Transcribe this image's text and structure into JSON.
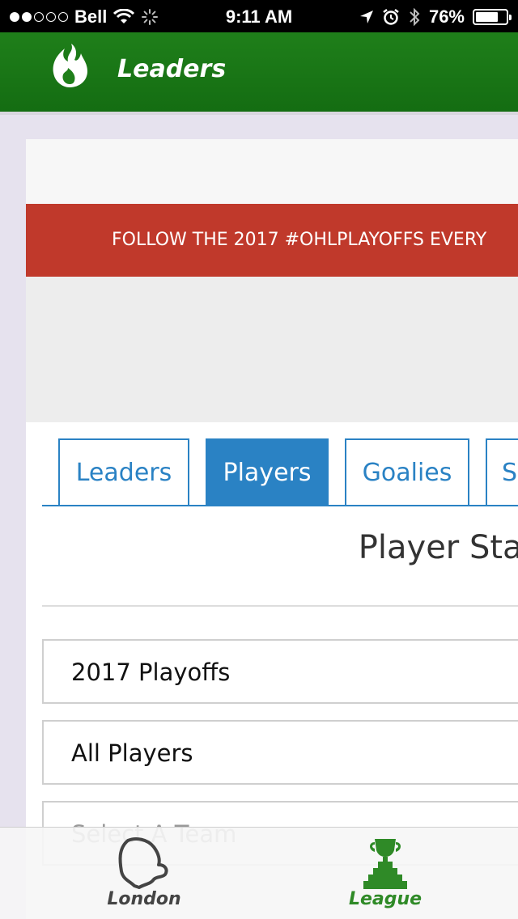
{
  "status_bar": {
    "carrier": "Bell",
    "time": "9:11 AM",
    "battery": "76%",
    "battery_level": 0.76,
    "signal_bars_filled": 2,
    "signal_bars_total": 5
  },
  "nav": {
    "title": "Leaders",
    "logo_icon": "flame-icon"
  },
  "banner": {
    "text": "FOLLOW THE 2017 #OHLPLAYOFFS EVERY",
    "color": "#c0392b"
  },
  "tabs": [
    {
      "label": "Leaders",
      "active": false
    },
    {
      "label": "Players",
      "active": true
    },
    {
      "label": "Goalies",
      "active": false
    },
    {
      "label": "S",
      "active": false
    }
  ],
  "section": {
    "title": "Player Statisti"
  },
  "selects": [
    {
      "value": "2017 Playoffs"
    },
    {
      "value": "All Players"
    },
    {
      "placeholder": "Select A Team"
    }
  ],
  "tab_bar": {
    "items": [
      {
        "label": "London",
        "icon": "london-map-icon"
      },
      {
        "label": "League",
        "icon": "trophy-icon"
      }
    ]
  },
  "colors": {
    "nav_green": "#1f7f1a",
    "accent_blue": "#2a82c4",
    "banner_red": "#c0392b",
    "league_green": "#2f8a27"
  }
}
